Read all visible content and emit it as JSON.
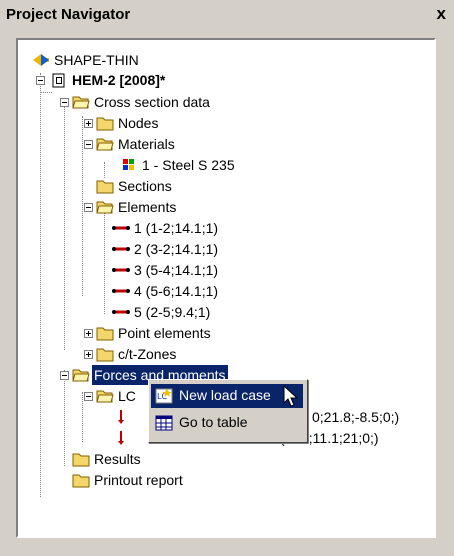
{
  "window": {
    "title": "Project Navigator",
    "close_glyph": "x"
  },
  "tree": {
    "root": "SHAPE-THIN",
    "project": "HEM-2 [2008]*",
    "cross_section": "Cross section data",
    "nodes": "Nodes",
    "materials": "Materials",
    "material_1": "1 - Steel S 235",
    "sections": "Sections",
    "elements": "Elements",
    "element_list": [
      "1 (1-2;14.1;1)",
      "2 (3-2;14.1;1)",
      "3 (5-4;14.1;1)",
      "4 (5-6;14.1;1)",
      "5 (2-5;9.4;1)"
    ],
    "point_elements": "Point elements",
    "ct_zones": "c/t-Zones",
    "forces": "Forces and moments",
    "lc": "LC",
    "lc_item_1_tail": "0;21.8;-8.5;0;)",
    "lc_item_2_tail": "(-1.3;11.1;21;0;)",
    "results": "Results",
    "printout": "Printout report"
  },
  "context_menu": {
    "items": [
      {
        "label": "New load case",
        "icon": "new-load-case-icon",
        "active": true
      },
      {
        "label": "Go to table",
        "icon": "table-icon",
        "active": false
      }
    ]
  },
  "colors": {
    "highlight": "#0a246a",
    "folder": "#f4d76a",
    "element_line": "#c00000"
  }
}
